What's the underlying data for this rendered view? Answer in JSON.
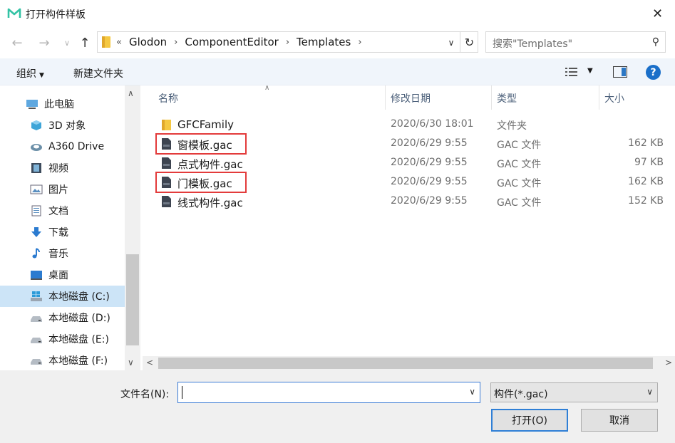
{
  "window": {
    "title": "打开构件样板",
    "close": "✕"
  },
  "nav": {
    "crumb_prefix": "«",
    "breadcrumbs": [
      "Glodon",
      "ComponentEditor",
      "Templates"
    ],
    "search_placeholder": "搜索\"Templates\""
  },
  "toolbar": {
    "organize": "组织",
    "new_folder": "新建文件夹",
    "help": "?"
  },
  "sidebar": {
    "items": [
      {
        "label": "此电脑",
        "icon": "computer-icon"
      },
      {
        "label": "3D 对象",
        "icon": "cube-icon"
      },
      {
        "label": "A360 Drive",
        "icon": "cloud-drive-icon"
      },
      {
        "label": "视频",
        "icon": "video-icon"
      },
      {
        "label": "图片",
        "icon": "picture-icon"
      },
      {
        "label": "文档",
        "icon": "document-icon"
      },
      {
        "label": "下载",
        "icon": "download-icon"
      },
      {
        "label": "音乐",
        "icon": "music-icon"
      },
      {
        "label": "桌面",
        "icon": "desktop-icon"
      },
      {
        "label": "本地磁盘 (C:)",
        "icon": "windows-drive-icon",
        "selected": true
      },
      {
        "label": "本地磁盘 (D:)",
        "icon": "drive-icon"
      },
      {
        "label": "本地磁盘 (E:)",
        "icon": "drive-icon"
      },
      {
        "label": "本地磁盘 (F:)",
        "icon": "drive-icon"
      }
    ]
  },
  "columns": {
    "name": "名称",
    "modified": "修改日期",
    "type": "类型",
    "size": "大小"
  },
  "files": [
    {
      "name": "GFCFamily",
      "modified": "2020/6/30 18:01",
      "type": "文件夹",
      "size": "",
      "icon": "folder-icon",
      "highlighted": false
    },
    {
      "name": "窗模板.gac",
      "modified": "2020/6/29 9:55",
      "type": "GAC 文件",
      "size": "162 KB",
      "icon": "gac-file-icon",
      "highlighted": true
    },
    {
      "name": "点式构件.gac",
      "modified": "2020/6/29 9:55",
      "type": "GAC 文件",
      "size": "97 KB",
      "icon": "gac-file-icon",
      "highlighted": false
    },
    {
      "name": "门模板.gac",
      "modified": "2020/6/29 9:55",
      "type": "GAC 文件",
      "size": "162 KB",
      "icon": "gac-file-icon",
      "highlighted": true
    },
    {
      "name": "线式构件.gac",
      "modified": "2020/6/29 9:55",
      "type": "GAC 文件",
      "size": "152 KB",
      "icon": "gac-file-icon",
      "highlighted": false
    }
  ],
  "footer": {
    "filename_label": "文件名(N):",
    "filename_value": "",
    "filetype": "构件(*.gac)",
    "open": "打开(O)",
    "cancel": "取消"
  },
  "colors": {
    "accent": "#1a6fc9",
    "highlight_box": "#e33b3b",
    "selected_row": "#cce4f7"
  }
}
